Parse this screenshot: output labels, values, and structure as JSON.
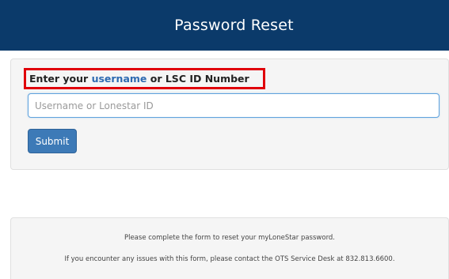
{
  "header": {
    "title": "Password Reset",
    "background": "#0b3a6a"
  },
  "form": {
    "prompt_prefix": "Enter your ",
    "prompt_highlight": "username",
    "prompt_suffix": " or LSC ID Number",
    "input_placeholder": "Username or Lonestar ID",
    "input_value": "",
    "submit_label": "Submit"
  },
  "footer": {
    "line1": "Please complete the form to reset your myLoneStar password.",
    "line2": "If you encounter any issues with this form, please contact the OTS Service Desk at 832.813.6600."
  }
}
